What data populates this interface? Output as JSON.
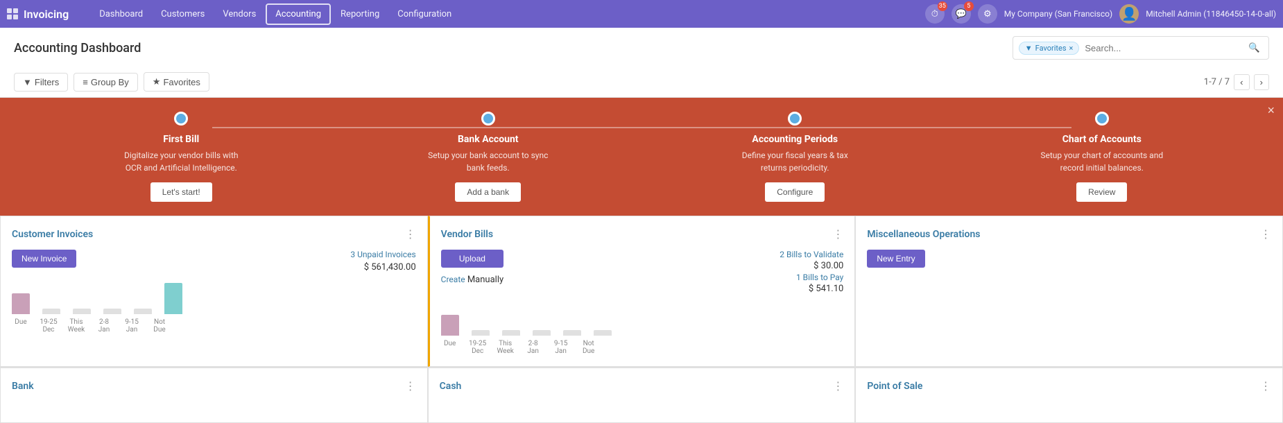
{
  "app": {
    "name": "Invoicing",
    "title": "Accounting Dashboard"
  },
  "nav": {
    "items": [
      {
        "id": "dashboard",
        "label": "Dashboard",
        "active": false
      },
      {
        "id": "customers",
        "label": "Customers",
        "active": false
      },
      {
        "id": "vendors",
        "label": "Vendors",
        "active": false
      },
      {
        "id": "accounting",
        "label": "Accounting",
        "active": true
      },
      {
        "id": "reporting",
        "label": "Reporting",
        "active": false
      },
      {
        "id": "configuration",
        "label": "Configuration",
        "active": false
      }
    ],
    "badges": {
      "activity": "35",
      "messages": "5"
    },
    "company": "My Company (San Francisco)",
    "user": "Mitchell Admin (11846450-14-0-all)"
  },
  "toolbar": {
    "filters_label": "Filters",
    "groupby_label": "Group By",
    "favorites_label": "Favorites",
    "search_tag": "Favorites",
    "search_placeholder": "Search...",
    "pagination": "1-7 / 7"
  },
  "onboarding": {
    "steps": [
      {
        "title": "First Bill",
        "desc": "Digitalize your vendor bills with OCR and Artificial Intelligence.",
        "button": "Let's start!"
      },
      {
        "title": "Bank Account",
        "desc": "Setup your bank account to sync bank feeds.",
        "button": "Add a bank"
      },
      {
        "title": "Accounting Periods",
        "desc": "Define your fiscal years & tax returns periodicity.",
        "button": "Configure"
      },
      {
        "title": "Chart of Accounts",
        "desc": "Setup your chart of accounts and record initial balances.",
        "button": "Review"
      }
    ]
  },
  "cards": {
    "customer_invoices": {
      "title": "Customer Invoices",
      "new_btn": "New Invoice",
      "unpaid_link": "3 Unpaid Invoices",
      "amount": "$ 561,430.00",
      "chart_labels": [
        "Due",
        "19-25 Dec",
        "This Week",
        "2-8 Jan",
        "9-15 Jan",
        "Not Due"
      ]
    },
    "vendor_bills": {
      "title": "Vendor Bills",
      "upload_btn": "Upload",
      "create_label": "Create",
      "manually_label": " Manually",
      "bills_validate_link": "2 Bills to Validate",
      "bills_pay_link": "1 Bills to Pay",
      "amount_validate": "$ 30.00",
      "amount_pay": "$ 541.10",
      "chart_labels": [
        "Due",
        "19-25 Dec",
        "This Week",
        "2-8 Jan",
        "9-15 Jan",
        "Not Due"
      ]
    },
    "misc_operations": {
      "title": "Miscellaneous Operations",
      "new_btn": "New Entry"
    },
    "bank": {
      "title": "Bank"
    },
    "cash": {
      "title": "Cash"
    },
    "point_of_sale": {
      "title": "Point of Sale"
    }
  },
  "icons": {
    "grid": "⊞",
    "search": "🔍",
    "filter": "▼",
    "star": "★",
    "chevron_left": "‹",
    "chevron_right": "›",
    "kebab": "⋮",
    "close": "×"
  }
}
